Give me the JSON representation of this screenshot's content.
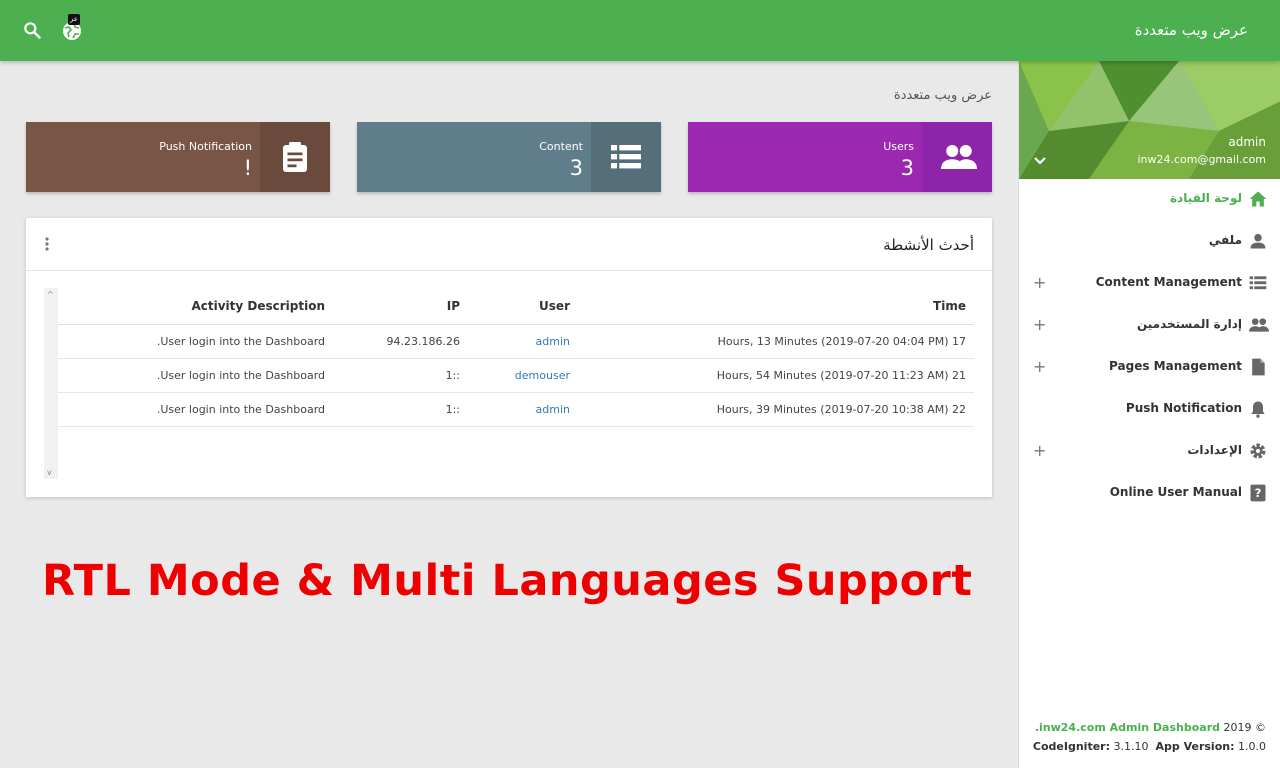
{
  "app": {
    "title": "عرض ويب متعددة",
    "lang_badge": "عر"
  },
  "colors": {
    "primary": "#4caf50",
    "push_card": "#795548",
    "content_card": "#607d8b",
    "users_card": "#9c27b0"
  },
  "page": {
    "subtitle": "عرض ويب متعددة"
  },
  "cards": [
    {
      "label": "Push Notification",
      "value": "!",
      "icon": "clipboard-icon"
    },
    {
      "label": "Content",
      "value": "3",
      "icon": "list-icon"
    },
    {
      "label": "Users",
      "value": "3",
      "icon": "users-icon"
    }
  ],
  "activity": {
    "title": "أحدث الأنشطة",
    "headers": {
      "time": "Time",
      "user": "User",
      "ip": "IP",
      "description": "Activity Description"
    },
    "rows": [
      {
        "time": "17 Hours, 13 Minutes (2019-07-20 04:04 PM)",
        "user": "admin",
        "ip": "94.23.186.26",
        "description": "User login into the Dashboard."
      },
      {
        "time": "21 Hours, 54 Minutes (2019-07-20 11:23 AM)",
        "user": "demouser",
        "ip": "::1",
        "description": "User login into the Dashboard."
      },
      {
        "time": "22 Hours, 39 Minutes (2019-07-20 10:38 AM)",
        "user": "admin",
        "ip": "::1",
        "description": "User login into the Dashboard."
      }
    ]
  },
  "sidebar": {
    "user": {
      "name": "admin",
      "email": "inw24.com@gmail.com"
    },
    "items": [
      {
        "label": "لوحة القيادة",
        "icon": "home-icon",
        "expandable": false,
        "active": true
      },
      {
        "label": "ملفي",
        "icon": "person-icon",
        "expandable": false,
        "active": false
      },
      {
        "label": "Content Management",
        "icon": "list-icon",
        "expandable": true,
        "active": false
      },
      {
        "label": "إدارة المستخدمين",
        "icon": "users-icon",
        "expandable": true,
        "active": false
      },
      {
        "label": "Pages Management",
        "icon": "file-icon",
        "expandable": true,
        "active": false
      },
      {
        "label": "Push Notification",
        "icon": "bell-icon",
        "expandable": false,
        "active": false
      },
      {
        "label": "الإعدادات",
        "icon": "gear-icon",
        "expandable": true,
        "active": false
      },
      {
        "label": "Online User Manual",
        "icon": "help-icon",
        "expandable": false,
        "active": false
      }
    ],
    "footer": {
      "copyright_prefix": "© 2019",
      "brand": "inw24.com Admin Dashboard.",
      "codeigniter_label": "CodeIgniter:",
      "codeigniter_version": "3.1.10",
      "app_version_label": "App Version:",
      "app_version": "1.0.0"
    }
  },
  "promo": {
    "text": "RTL Mode & Multi Languages Support"
  }
}
